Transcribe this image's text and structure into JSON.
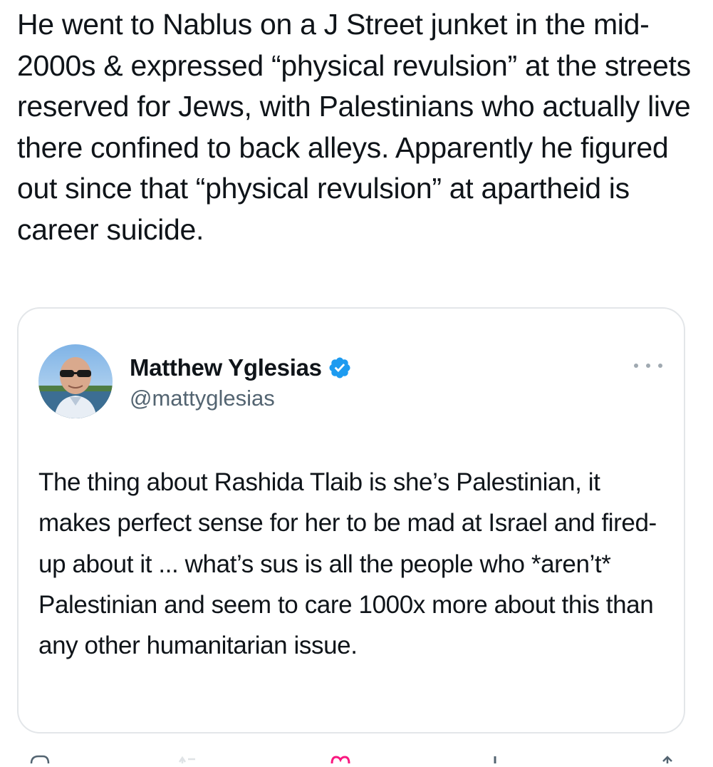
{
  "post": {
    "text": "He went to Nablus on a J Street junket in the mid-2000s & expressed “physical revulsion” at the streets reserved for Jews, with Palestinians who actually live there confined to back alleys. Apparently he figured out since that “physical revulsion” at apartheid is career suicide."
  },
  "quoted_post": {
    "author_name": "Matthew Yglesias",
    "author_handle": "@mattyglesias",
    "verified": true,
    "text": "The thing about Rashida Tlaib is she’s Palestinian, it makes perfect sense for her to be mad at Israel and fired-up about it ... what’s sus is all the people who *aren’t* Palestinian and seem to care 1000x more about this than any other humanitarian issue."
  },
  "colors": {
    "text_primary": "#0f1419",
    "text_secondary": "#536471",
    "verified_blue": "#1d9bf0",
    "border": "#e3e6e9",
    "like_pink": "#f91880"
  },
  "icons": {
    "verified": "verified-badge-icon",
    "more": "more-dots-icon",
    "reply": "reply-icon",
    "repost": "repost-icon",
    "like": "like-icon",
    "views": "views-icon",
    "share": "share-icon"
  }
}
